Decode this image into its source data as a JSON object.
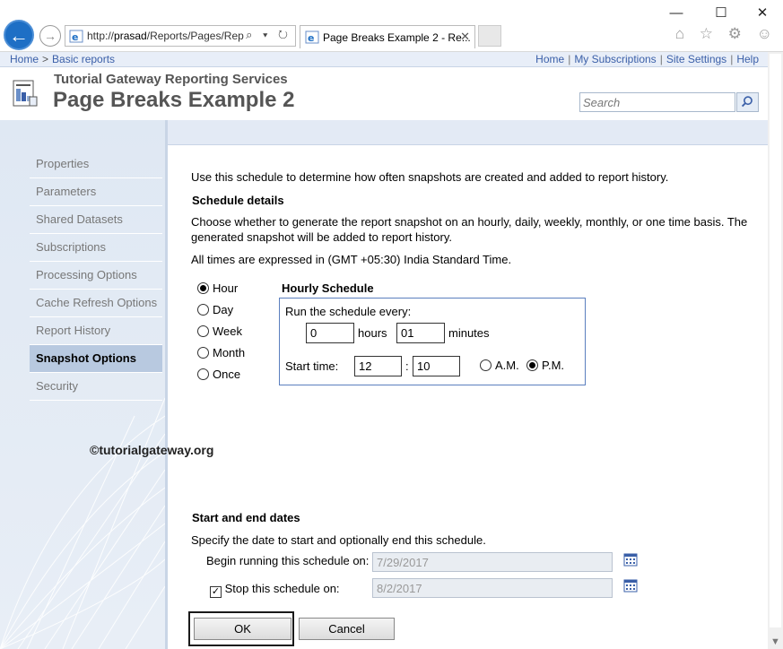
{
  "browser": {
    "window_controls": {
      "minimize": "—",
      "maximize": "☐",
      "close": "✕"
    },
    "url_prefix": "http://",
    "url_host": "prasad",
    "url_path": "/Reports/Pages/Rep",
    "address_tools": "⌕ ▾ ↻",
    "tab_title": "Page Breaks Example 2 - Re...",
    "tab_close": "✕",
    "toolbar_icons": "⌂ ☆ ⚙ ☺"
  },
  "topnav": {
    "crumbs": [
      "Home",
      "Basic reports"
    ],
    "crumb_sep": ">",
    "links": [
      "Home",
      "My Subscriptions",
      "Site Settings",
      "Help"
    ],
    "link_sep": "|"
  },
  "header": {
    "site_name": "Tutorial Gateway Reporting Services",
    "page_title": "Page Breaks Example 2",
    "search_placeholder": "Search"
  },
  "sidebar": {
    "items": [
      {
        "label": "Properties",
        "active": false
      },
      {
        "label": "Parameters",
        "active": false
      },
      {
        "label": "Shared Datasets",
        "active": false
      },
      {
        "label": "Subscriptions",
        "active": false
      },
      {
        "label": "Processing Options",
        "active": false
      },
      {
        "label": "Cache Refresh Options",
        "active": false
      },
      {
        "label": "Report History",
        "active": false
      },
      {
        "label": "Snapshot Options",
        "active": true
      },
      {
        "label": "Security",
        "active": false
      }
    ]
  },
  "main": {
    "intro": "Use this schedule to determine how often snapshots are created and added to report history.",
    "schedule_details_heading": "Schedule details",
    "schedule_details_line1": "Choose whether to generate the report snapshot on an hourly, daily, weekly, monthly, or one time basis. The",
    "schedule_details_line2": "generated snapshot will be added to report history.",
    "timezone": "All times are expressed in (GMT +05:30) India Standard Time.",
    "frequency_options": [
      "Hour",
      "Day",
      "Week",
      "Month",
      "Once"
    ],
    "frequency_selected": "Hour",
    "hourly": {
      "heading": "Hourly Schedule",
      "run_every_label": "Run the schedule every:",
      "hours_value": "0",
      "hours_label": "hours",
      "minutes_value": "01",
      "minutes_label": "minutes",
      "start_time_label": "Start time:",
      "start_hour": "12",
      "time_sep": ":",
      "start_minute": "10",
      "am_label": "A.M.",
      "pm_label": "P.M.",
      "meridiem_selected": "P.M."
    },
    "watermark": "©tutorialgateway.org",
    "dates": {
      "heading": "Start and end dates",
      "description": "Specify the date to start and optionally end this schedule.",
      "begin_label": "Begin running this schedule on:",
      "begin_value": "7/29/2017",
      "stop_label": "Stop this schedule on:",
      "stop_checked": true,
      "stop_check_mark": "✓",
      "stop_value": "8/2/2017"
    },
    "ok_label": "OK",
    "cancel_label": "Cancel"
  },
  "colors": {
    "accent_blue": "#3a5fa8",
    "sidebar_active": "#b8c9e0",
    "box_border": "#5b7fbf"
  }
}
